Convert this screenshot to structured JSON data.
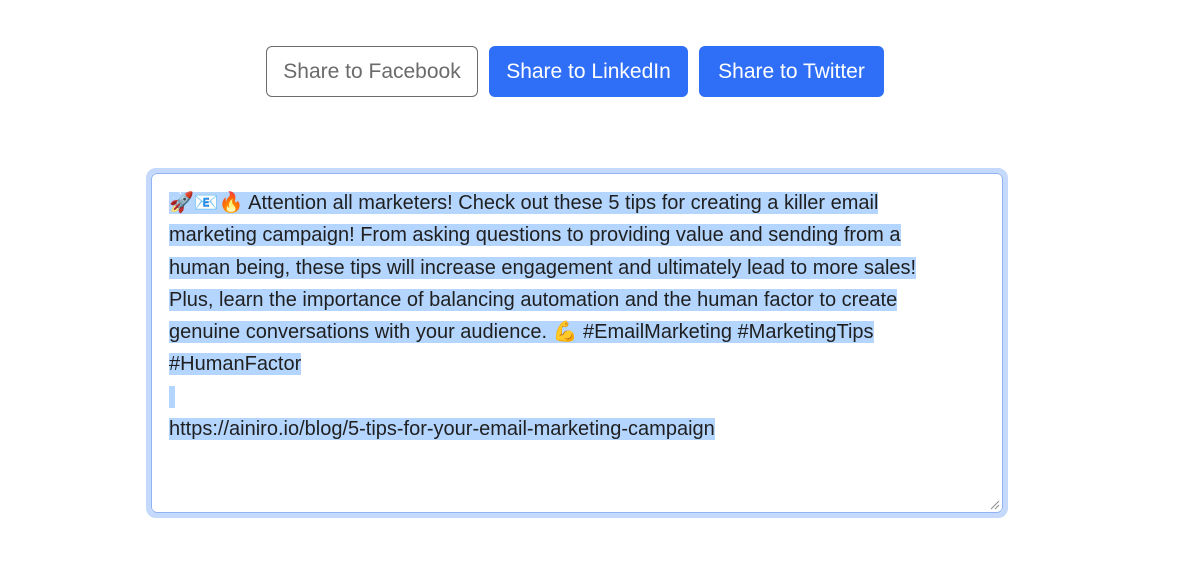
{
  "share": {
    "facebook_label": "Share to Facebook",
    "linkedin_label": "Share to LinkedIn",
    "twitter_label": "Share to Twitter"
  },
  "post": {
    "line1": "🚀📧🔥 Attention all marketers! Check out these 5 tips for creating a killer email",
    "line2": "marketing campaign! From asking questions to providing value and sending from a",
    "line3": "human being, these tips will increase engagement and ultimately lead to more sales!",
    "line4": "Plus, learn the importance of balancing automation and the human factor to create",
    "line5": "genuine conversations with your audience. 💪 #EmailMarketing #MarketingTips",
    "line6": "#HumanFactor",
    "line7": " ",
    "line8": "https://ainiro.io/blog/5-tips-for-your-email-marketing-campaign"
  },
  "colors": {
    "primary": "#2f6ff7",
    "selection": "#b4d5fe",
    "focus_ring": "#c4d9fb"
  },
  "icons": {
    "resize": "resize-handle-icon"
  }
}
